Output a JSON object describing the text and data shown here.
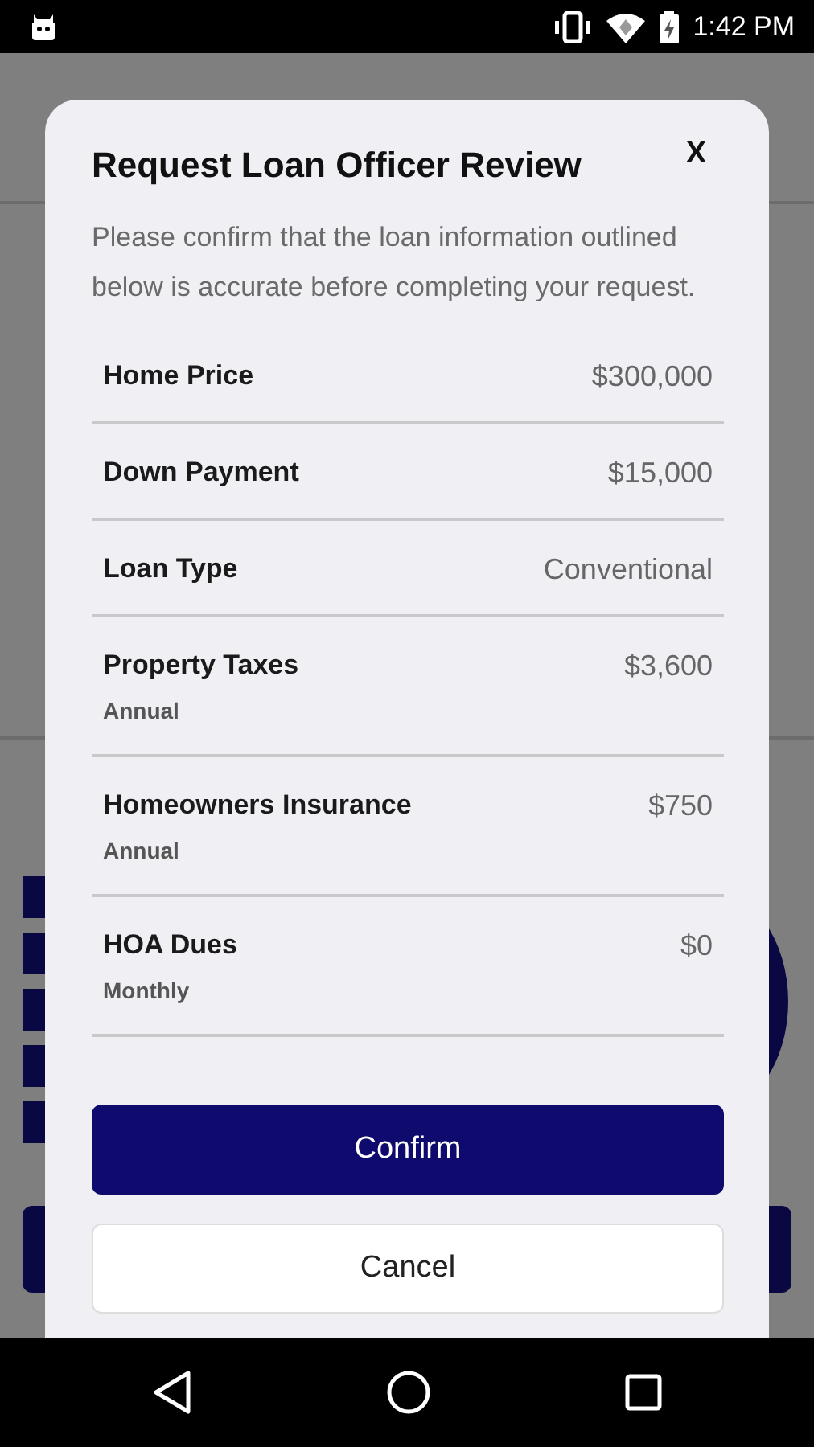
{
  "status_bar": {
    "time": "1:42 PM"
  },
  "dialog": {
    "title": "Request Loan Officer Review",
    "close": "X",
    "message": "Please confirm that the loan information outlined below is accurate before completing your request.",
    "rows": [
      {
        "label": "Home Price",
        "value": "$300,000"
      },
      {
        "label": "Down Payment",
        "value": "$15,000"
      },
      {
        "label": "Loan Type",
        "value": "Conventional"
      },
      {
        "label": "Property Taxes",
        "note": "Annual",
        "value": "$3,600"
      },
      {
        "label": "Homeowners Insurance",
        "note": "Annual",
        "value": "$750"
      },
      {
        "label": "HOA Dues",
        "note": "Monthly",
        "value": "$0"
      }
    ],
    "buttons": [
      {
        "label": "Confirm",
        "kind": "primary"
      },
      {
        "label": "Cancel",
        "kind": "secondary"
      }
    ]
  }
}
